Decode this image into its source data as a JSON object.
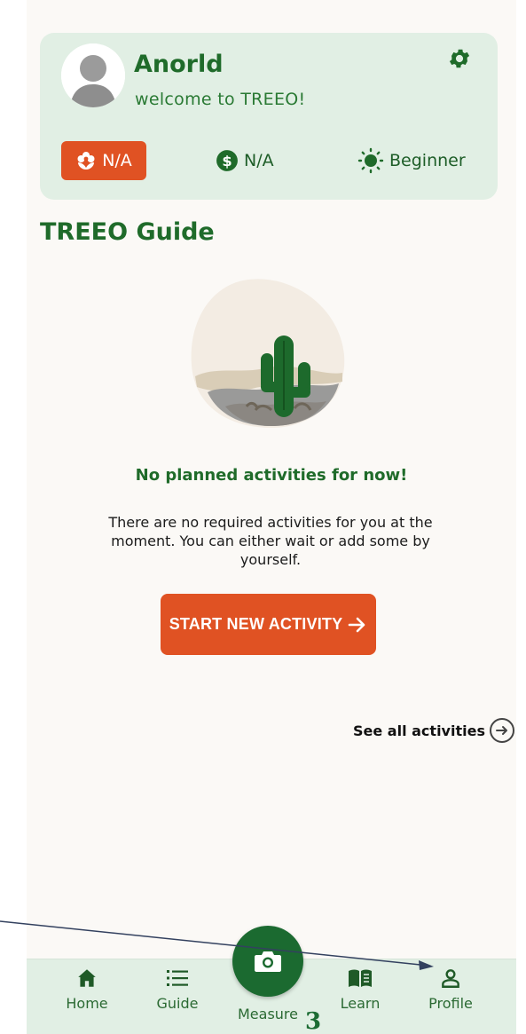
{
  "profile": {
    "name": "Anorld",
    "welcome": "welcome to TREEO!",
    "stats": {
      "flower_value": "N/A",
      "money_value": "N/A",
      "level": "Beginner"
    }
  },
  "guide": {
    "title": "TREEO Guide",
    "empty_title": "No planned activities for now!",
    "empty_description": "There are no required activities for you at the moment. You can either wait or add some by yourself.",
    "start_button": "START NEW ACTIVITY",
    "see_all": "See all activities"
  },
  "bottom_nav": {
    "items": [
      {
        "label": "Home",
        "icon": "home-icon"
      },
      {
        "label": "Guide",
        "icon": "list-icon"
      },
      {
        "label": "Measure",
        "icon": "camera-icon"
      },
      {
        "label": "Learn",
        "icon": "book-icon"
      },
      {
        "label": "Profile",
        "icon": "person-icon"
      }
    ]
  },
  "annotation": {
    "number": "3"
  },
  "colors": {
    "brand_green": "#1f6b2a",
    "card_background": "#e1efe4",
    "accent_orange": "#e05223",
    "screen_background": "#fbf9f6"
  }
}
